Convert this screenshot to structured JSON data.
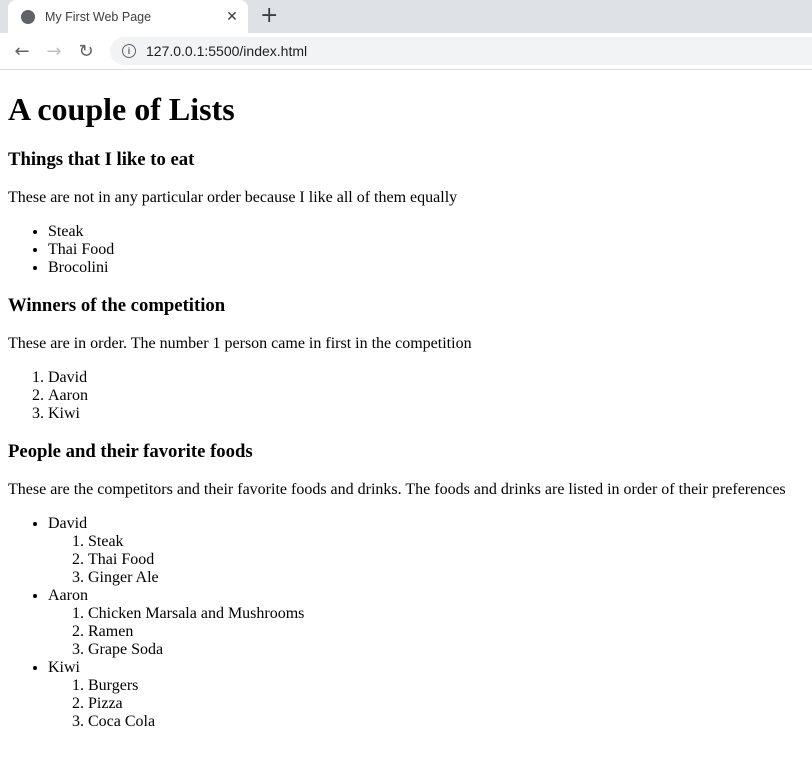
{
  "browser": {
    "tab_title": "My First Web Page",
    "url": "127.0.0.1:5500/index.html",
    "icons": {
      "tab": "globe-icon",
      "close": "close-icon",
      "new_tab": "plus-icon",
      "back": "arrow-left-icon",
      "forward": "arrow-right-icon",
      "reload": "reload-icon",
      "site_info": "info-icon"
    }
  },
  "page": {
    "title": "A couple of Lists",
    "sections": [
      {
        "heading": "Things that I like to eat",
        "description": "These are not in any particular order because I like all of them equally",
        "list_type": "unordered",
        "items": [
          "Steak",
          "Thai Food",
          "Brocolini"
        ]
      },
      {
        "heading": "Winners of the competition",
        "description": "These are in order. The number 1 person came in first in the competition",
        "list_type": "ordered",
        "items": [
          "David",
          "Aaron",
          "Kiwi"
        ]
      },
      {
        "heading": "People and their favorite foods",
        "description": "These are the competitors and their favorite foods and drinks. The foods and drinks are listed in order of their preferences",
        "list_type": "nested",
        "people": [
          {
            "name": "David",
            "favorites": [
              "Steak",
              "Thai Food",
              "Ginger Ale"
            ]
          },
          {
            "name": "Aaron",
            "favorites": [
              "Chicken Marsala and Mushrooms",
              "Ramen",
              "Grape Soda"
            ]
          },
          {
            "name": "Kiwi",
            "favorites": [
              "Burgers",
              "Pizza",
              "Coca Cola"
            ]
          }
        ]
      }
    ]
  }
}
